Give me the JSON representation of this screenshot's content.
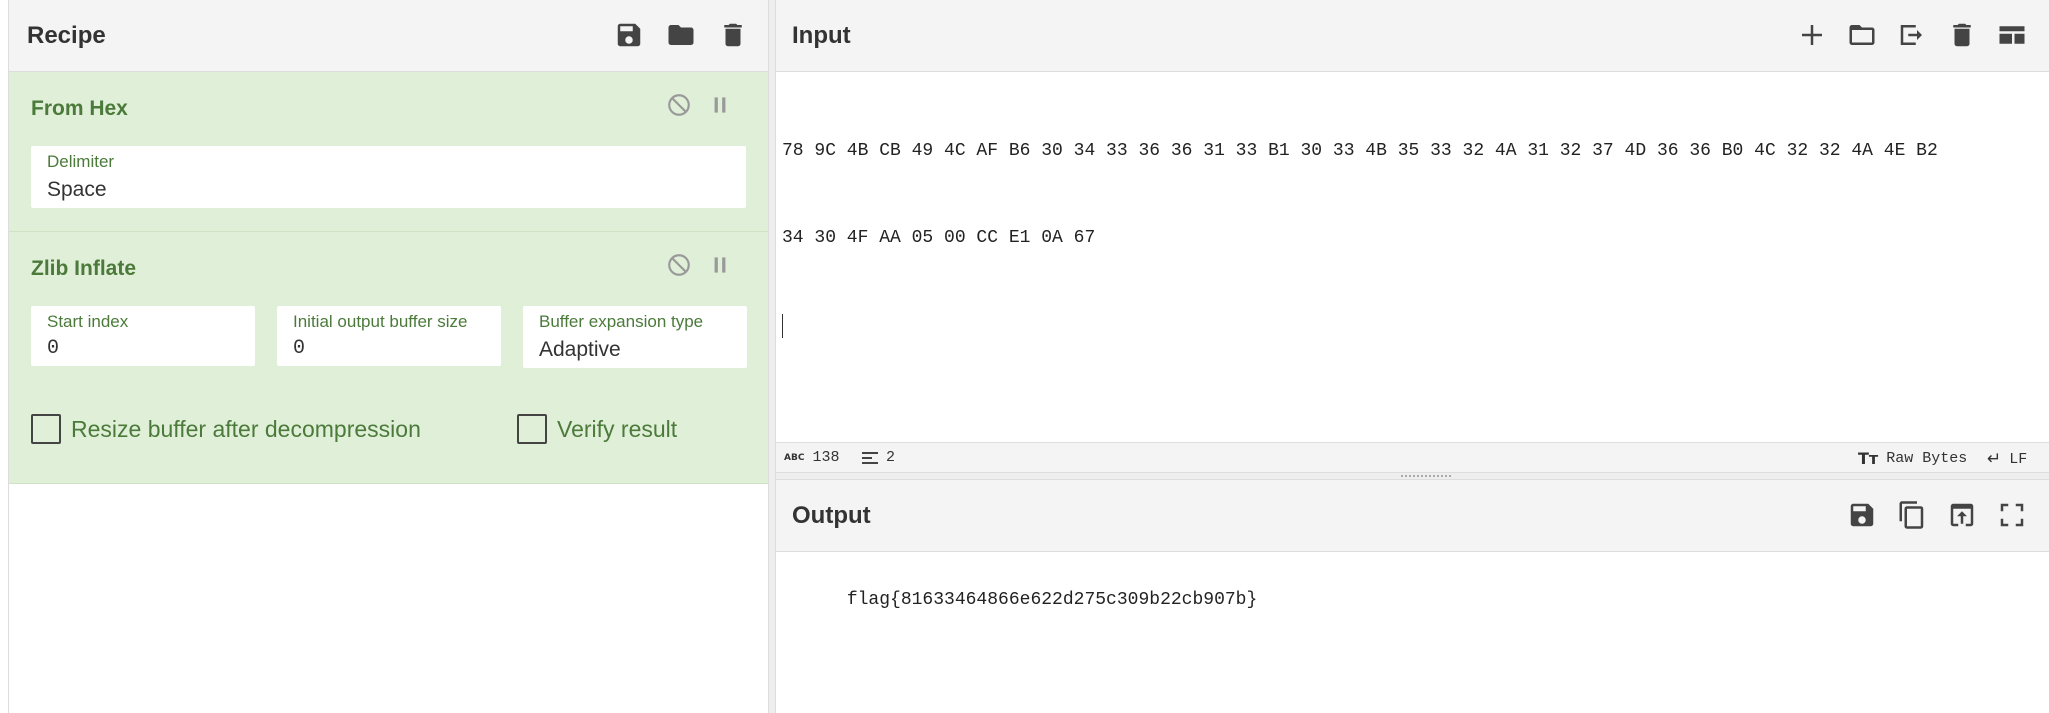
{
  "recipe": {
    "title": "Recipe",
    "icons": [
      "save-icon",
      "folder-icon",
      "trash-icon"
    ],
    "operations": [
      {
        "name": "From Hex",
        "fields": [
          {
            "label": "Delimiter",
            "value": "Space"
          }
        ]
      },
      {
        "name": "Zlib Inflate",
        "fields": [
          {
            "label": "Start index",
            "value": "0"
          },
          {
            "label": "Initial output buffer size",
            "value": "0"
          },
          {
            "label": "Buffer expansion type",
            "value": "Adaptive"
          }
        ],
        "checkboxes": [
          {
            "label": "Resize buffer after decompression",
            "checked": false
          },
          {
            "label": "Verify result",
            "checked": false
          }
        ]
      }
    ]
  },
  "input": {
    "title": "Input",
    "line1": "78 9C 4B CB 49 4C AF B6 30 34 33 36 36 31 33 B1 30 33 4B 35 33 32 4A 31 32 37 4D 36 36 B0 4C 32 32 4A 4E B2",
    "line2": "34 30 4F AA 05 00 CC E1 0A 67",
    "icons": [
      "add-icon",
      "open-folder-icon",
      "import-icon",
      "trash-icon",
      "layout-icon"
    ]
  },
  "status": {
    "abc_label": "ABC",
    "char_count": "138",
    "line_count": "2",
    "encoding": "Raw Bytes",
    "eol": "LF"
  },
  "output": {
    "title": "Output",
    "text": "flag{81633464866e622d275c309b22cb907b}",
    "icons": [
      "save-icon",
      "copy-icon",
      "replace-input-icon",
      "maximize-icon"
    ]
  }
}
